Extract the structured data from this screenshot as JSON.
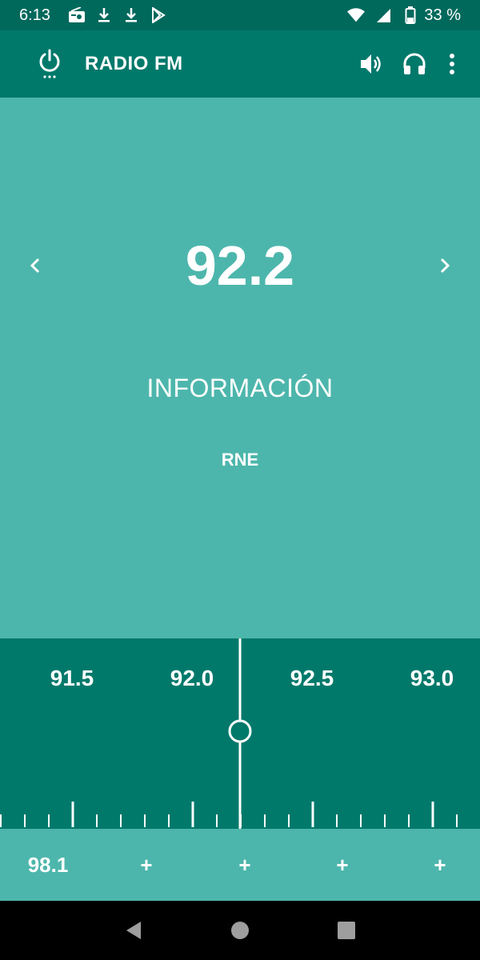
{
  "status_bar": {
    "time": "6:13",
    "battery": "33 %"
  },
  "app_bar": {
    "title": "RADIO FM"
  },
  "station": {
    "frequency": "92.2",
    "genre": "INFORMACIÓN",
    "name": "RNE"
  },
  "tuner": {
    "scale_labels": [
      "91.5",
      "92.0",
      "92.5",
      "93.0"
    ]
  },
  "presets": [
    {
      "label": "98.1"
    },
    {
      "label": "+"
    },
    {
      "label": "+"
    },
    {
      "label": "+"
    },
    {
      "label": "+"
    }
  ],
  "colors": {
    "primary_dark": "#00695c",
    "primary": "#00796b",
    "accent": "#4db6ac",
    "text": "#ffffff"
  },
  "icons": {
    "power": "power-icon",
    "volume": "volume-icon",
    "headphones": "headphones-icon",
    "more": "more-vert-icon"
  }
}
